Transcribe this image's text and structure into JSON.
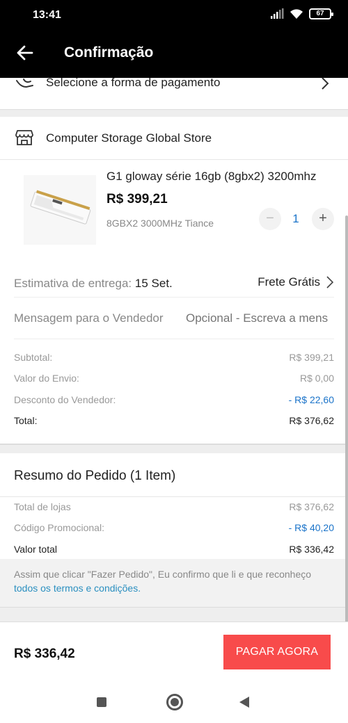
{
  "status_bar": {
    "time": "13:41",
    "battery": "67"
  },
  "header": {
    "title": "Confirmação"
  },
  "payment": {
    "label": "Selecione a forma de pagamento"
  },
  "store": {
    "name": "Computer Storage Global Store",
    "product": {
      "title": "G1 gloway série 16gb (8gbx2) 3200mhz",
      "price": "R$ 399,21",
      "variant": "8GBX2 3000MHz Tiance",
      "quantity": "1",
      "minus": "−",
      "plus": "+"
    },
    "delivery": {
      "label": "Estimativa de entrega:",
      "value": "15 Set.",
      "shipping": "Frete Grátis"
    },
    "message": {
      "label": "Mensagem para o Vendedor",
      "placeholder": "Opcional - Escreva a mens"
    },
    "summary": [
      {
        "label": "Subtotal:",
        "value": "R$ 399,21"
      },
      {
        "label": "Valor do Envio:",
        "value": "R$ 0,00"
      },
      {
        "label": "Desconto do Vendedor:",
        "value": "- R$ 22,60"
      },
      {
        "label": "Total:",
        "value": "R$ 376,62"
      }
    ]
  },
  "order_summary": {
    "title": "Resumo do Pedido (1 Item)",
    "rows": [
      {
        "label": "Total de lojas",
        "value": "R$ 376,62"
      },
      {
        "label": "Código Promocional:",
        "value": "- R$ 40,20"
      },
      {
        "label": "Valor total",
        "value": "R$ 336,42"
      }
    ],
    "terms_text": "Assim que clicar \"Fazer Pedido\", Eu confirmo que li e que reconheço ",
    "terms_link": "todos os termos e condições."
  },
  "bottom": {
    "total": "R$ 336,42",
    "pay_button": "PAGAR AGORA"
  },
  "colors": {
    "accent_red": "#f84b4b",
    "link_blue": "#2a8fc0",
    "discount_blue": "#1a73c9"
  },
  "icons": [
    "back-arrow-icon",
    "payment-hand-icon",
    "chevron-right-icon",
    "store-icon",
    "signal-icon",
    "wifi-icon",
    "battery-icon",
    "nav-square-icon",
    "nav-circle-icon",
    "nav-back-icon"
  ]
}
